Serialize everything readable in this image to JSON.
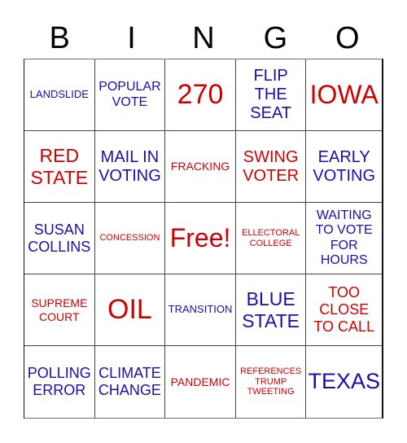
{
  "colors": {
    "red": "#cc0000",
    "blue": "#1a0dab",
    "header": "#000000"
  },
  "header": {
    "letters": [
      "B",
      "I",
      "N",
      "G",
      "O"
    ]
  },
  "board": {
    "cells": [
      {
        "text": "LANDSLIDE",
        "color": "blue",
        "size": "s-sm"
      },
      {
        "text": "POPULAR VOTE",
        "color": "blue",
        "size": "s-md"
      },
      {
        "text": "270",
        "color": "red",
        "size": "s-giant"
      },
      {
        "text": "FLIP THE SEAT",
        "color": "blue",
        "size": "s-lg2"
      },
      {
        "text": "IOWA",
        "color": "red",
        "size": "s-huge"
      },
      {
        "text": "RED STATE",
        "color": "red",
        "size": "s-xl"
      },
      {
        "text": "MAIL IN VOTING",
        "color": "blue",
        "size": "s-lg2"
      },
      {
        "text": "FRACKING",
        "color": "red",
        "size": "s-sm2"
      },
      {
        "text": "SWING VOTER",
        "color": "red",
        "size": "s-lg2"
      },
      {
        "text": "EARLY VOTING",
        "color": "blue",
        "size": "s-lg2"
      },
      {
        "text": "SUSAN COLLINS",
        "color": "blue",
        "size": "s-lg"
      },
      {
        "text": "CONCESSION",
        "color": "red",
        "size": "s-xs"
      },
      {
        "text": "Free!",
        "color": "red",
        "size": "s-huge"
      },
      {
        "text": "ELLECTORAL COLLEGE",
        "color": "red",
        "size": "s-xs"
      },
      {
        "text": "WAITING TO VOTE FOR HOURS",
        "color": "blue",
        "size": "s-md"
      },
      {
        "text": "SUPREME COURT",
        "color": "red",
        "size": "s-sm2"
      },
      {
        "text": "OIL",
        "color": "red",
        "size": "s-giant"
      },
      {
        "text": "TRANSITION",
        "color": "blue",
        "size": "s-sm"
      },
      {
        "text": "BLUE STATE",
        "color": "blue",
        "size": "s-xl"
      },
      {
        "text": "TOO CLOSE TO CALL",
        "color": "red",
        "size": "s-lg"
      },
      {
        "text": "POLLING ERROR",
        "color": "blue",
        "size": "s-lg"
      },
      {
        "text": "CLIMATE CHANGE",
        "color": "blue",
        "size": "s-lg"
      },
      {
        "text": "PANDEMIC",
        "color": "red",
        "size": "s-sm2"
      },
      {
        "text": "REFERENCES TRUMP TWEETING",
        "color": "red",
        "size": "s-xs"
      },
      {
        "text": "TEXAS",
        "color": "blue",
        "size": "s-xxl"
      }
    ]
  }
}
